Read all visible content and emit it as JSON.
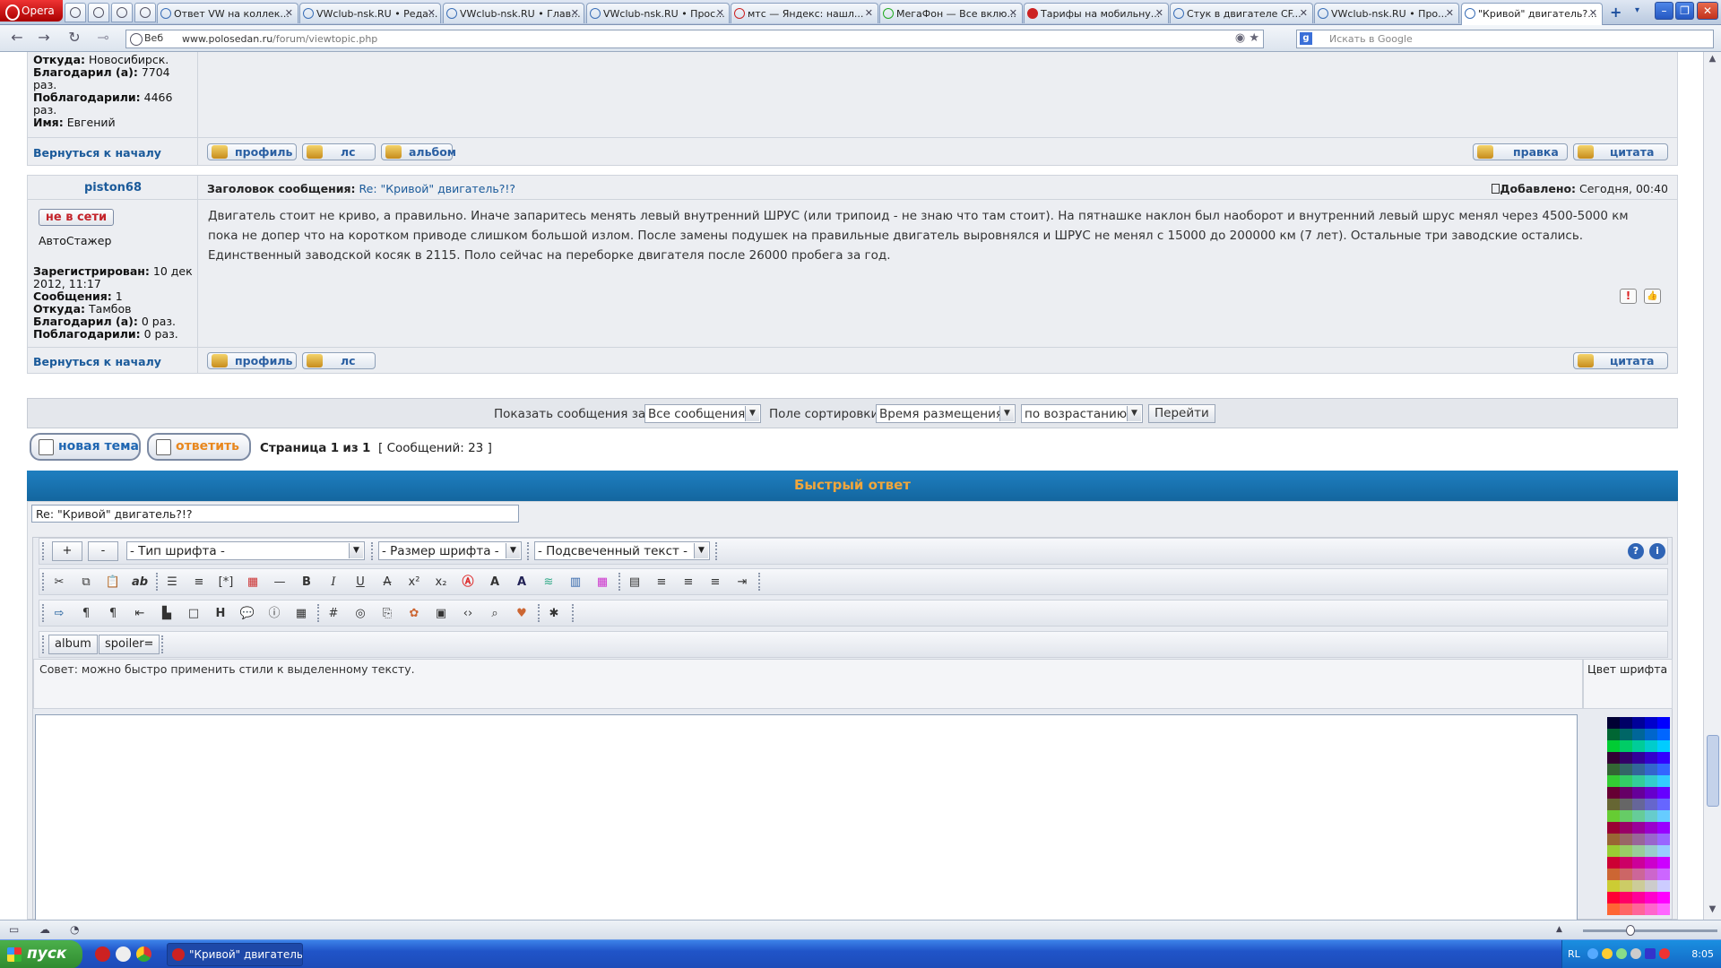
{
  "browser": {
    "menu_label": "Opera",
    "tabs": [
      {
        "label": "Ответ VW на коллек..."
      },
      {
        "label": "VWclub-nsk.RU • Реда..."
      },
      {
        "label": "VWclub-nsk.RU • Глав..."
      },
      {
        "label": "VWclub-nsk.RU • Прос..."
      },
      {
        "label": "мтс — Яндекс: нашл..."
      },
      {
        "label": "МегаФон — Все вклю..."
      },
      {
        "label": "Тарифы на мобильну..."
      },
      {
        "label": "Стук в двигателе CF..."
      },
      {
        "label": "VWclub-nsk.RU • Про..."
      },
      {
        "label": "\"Кривой\" двигатель?..."
      }
    ],
    "address_web_label": "Веб",
    "url_host": "www.polosedan.ru",
    "url_path": "/forum/viewtopic.php",
    "search_placeholder": "Искать в Google"
  },
  "post1": {
    "from_label": "Откуда:",
    "from_value": "Новосибирск.",
    "thanked_label": "Благодарил (а):",
    "thanked_value": "7704",
    "thanked_unit": "раз.",
    "received_label": "Поблагодарили:",
    "received_value": "4466",
    "received_unit": "раз.",
    "name_label": "Имя:",
    "name_value": "Евгений",
    "back_link": "Вернуться к началу",
    "btn_profile": "профиль",
    "btn_pm": "лс",
    "btn_album": "альбом",
    "btn_edit": "правка",
    "btn_quote": "цитата"
  },
  "post2": {
    "author": "piston68",
    "subject_label": "Заголовок сообщения:",
    "subject_value": "Re: \"Кривой\" двигатель?!?",
    "added_label": "Добавлено:",
    "added_value": "Сегодня, 00:40",
    "status": "не в сети",
    "rank": "АвтоСтажер",
    "reg_label": "Зарегистрирован:",
    "reg_value": "10 дек",
    "reg_value2": "2012, 11:17",
    "posts_label": "Сообщения:",
    "posts_value": "1",
    "from_label": "Откуда:",
    "from_value": "Тамбов",
    "thanked_label": "Благодарил (а):",
    "thanked_value": "0 раз.",
    "received_label": "Поблагодарили:",
    "received_value": "0 раз.",
    "body_line1": "Двигатель стоит не криво, а правильно. Иначе запаритесь менять левый внутренний ШРУС (или трипоид - не знаю что там стоит). На пятнашке наклон был наоборот и внутренний левый шрус менял через 4500-5000 км",
    "body_line2": "пока не допер что на коротком приводе слишком большой излом. После замены подушек на правильные двигатель выровнялся и ШРУС не менял с 15000 до 200000 км (7 лет). Остальные три заводские остались.",
    "body_line3": "Единственный заводской косяк в 2115. Поло сейчас на переборке двигателя после 26000 пробега за год.",
    "report_icon": "!",
    "thanks_icon": "👍",
    "back_link": "Вернуться к началу",
    "btn_profile": "профиль",
    "btn_pm": "лс",
    "btn_quote": "цитата"
  },
  "sortbar": {
    "show_label": "Показать сообщения за:",
    "show_value": "Все сообщения",
    "sort_label": "Поле сортировки",
    "sort_value": "Время размещения",
    "order_value": "по возрастанию",
    "go_label": "Перейти"
  },
  "pagination": {
    "new_topic": "новая тема",
    "reply": "ответить",
    "page_word": "Страница",
    "page_current": "1",
    "of_word": "из",
    "page_total": "1",
    "messages_text": "[ Сообщений: 23 ]"
  },
  "quick_reply": {
    "header": "Быстрый ответ",
    "subject_value": "Re: \"Кривой\" двигатель?!?",
    "plus": "+",
    "minus": "-",
    "font_type": "- Тип шрифта -",
    "font_size": "- Размер шрифта -",
    "highlight": "- Подсвеченный текст -",
    "help_icon": "?",
    "info_icon": "i",
    "bold": "B",
    "italic": "I",
    "underline": "U",
    "strike": "A",
    "superscript": "x²",
    "subscript": "x₂",
    "heading": "H",
    "album_btn": "album",
    "spoiler_btn": "spoiler=",
    "hint_text": "Совет: можно быстро применить стили к выделенному тексту.",
    "color_label": "Цвет шрифта"
  },
  "taskbar": {
    "start": "пуск",
    "task_item": "\"Кривой\" двигатель...",
    "lang": "RL",
    "clock": "8:05"
  },
  "colors": {
    "header_blue": "#1772b4",
    "accent_orange": "#f0a63c",
    "link_blue": "#1a5a9a",
    "offline_red": "#c4242a"
  }
}
